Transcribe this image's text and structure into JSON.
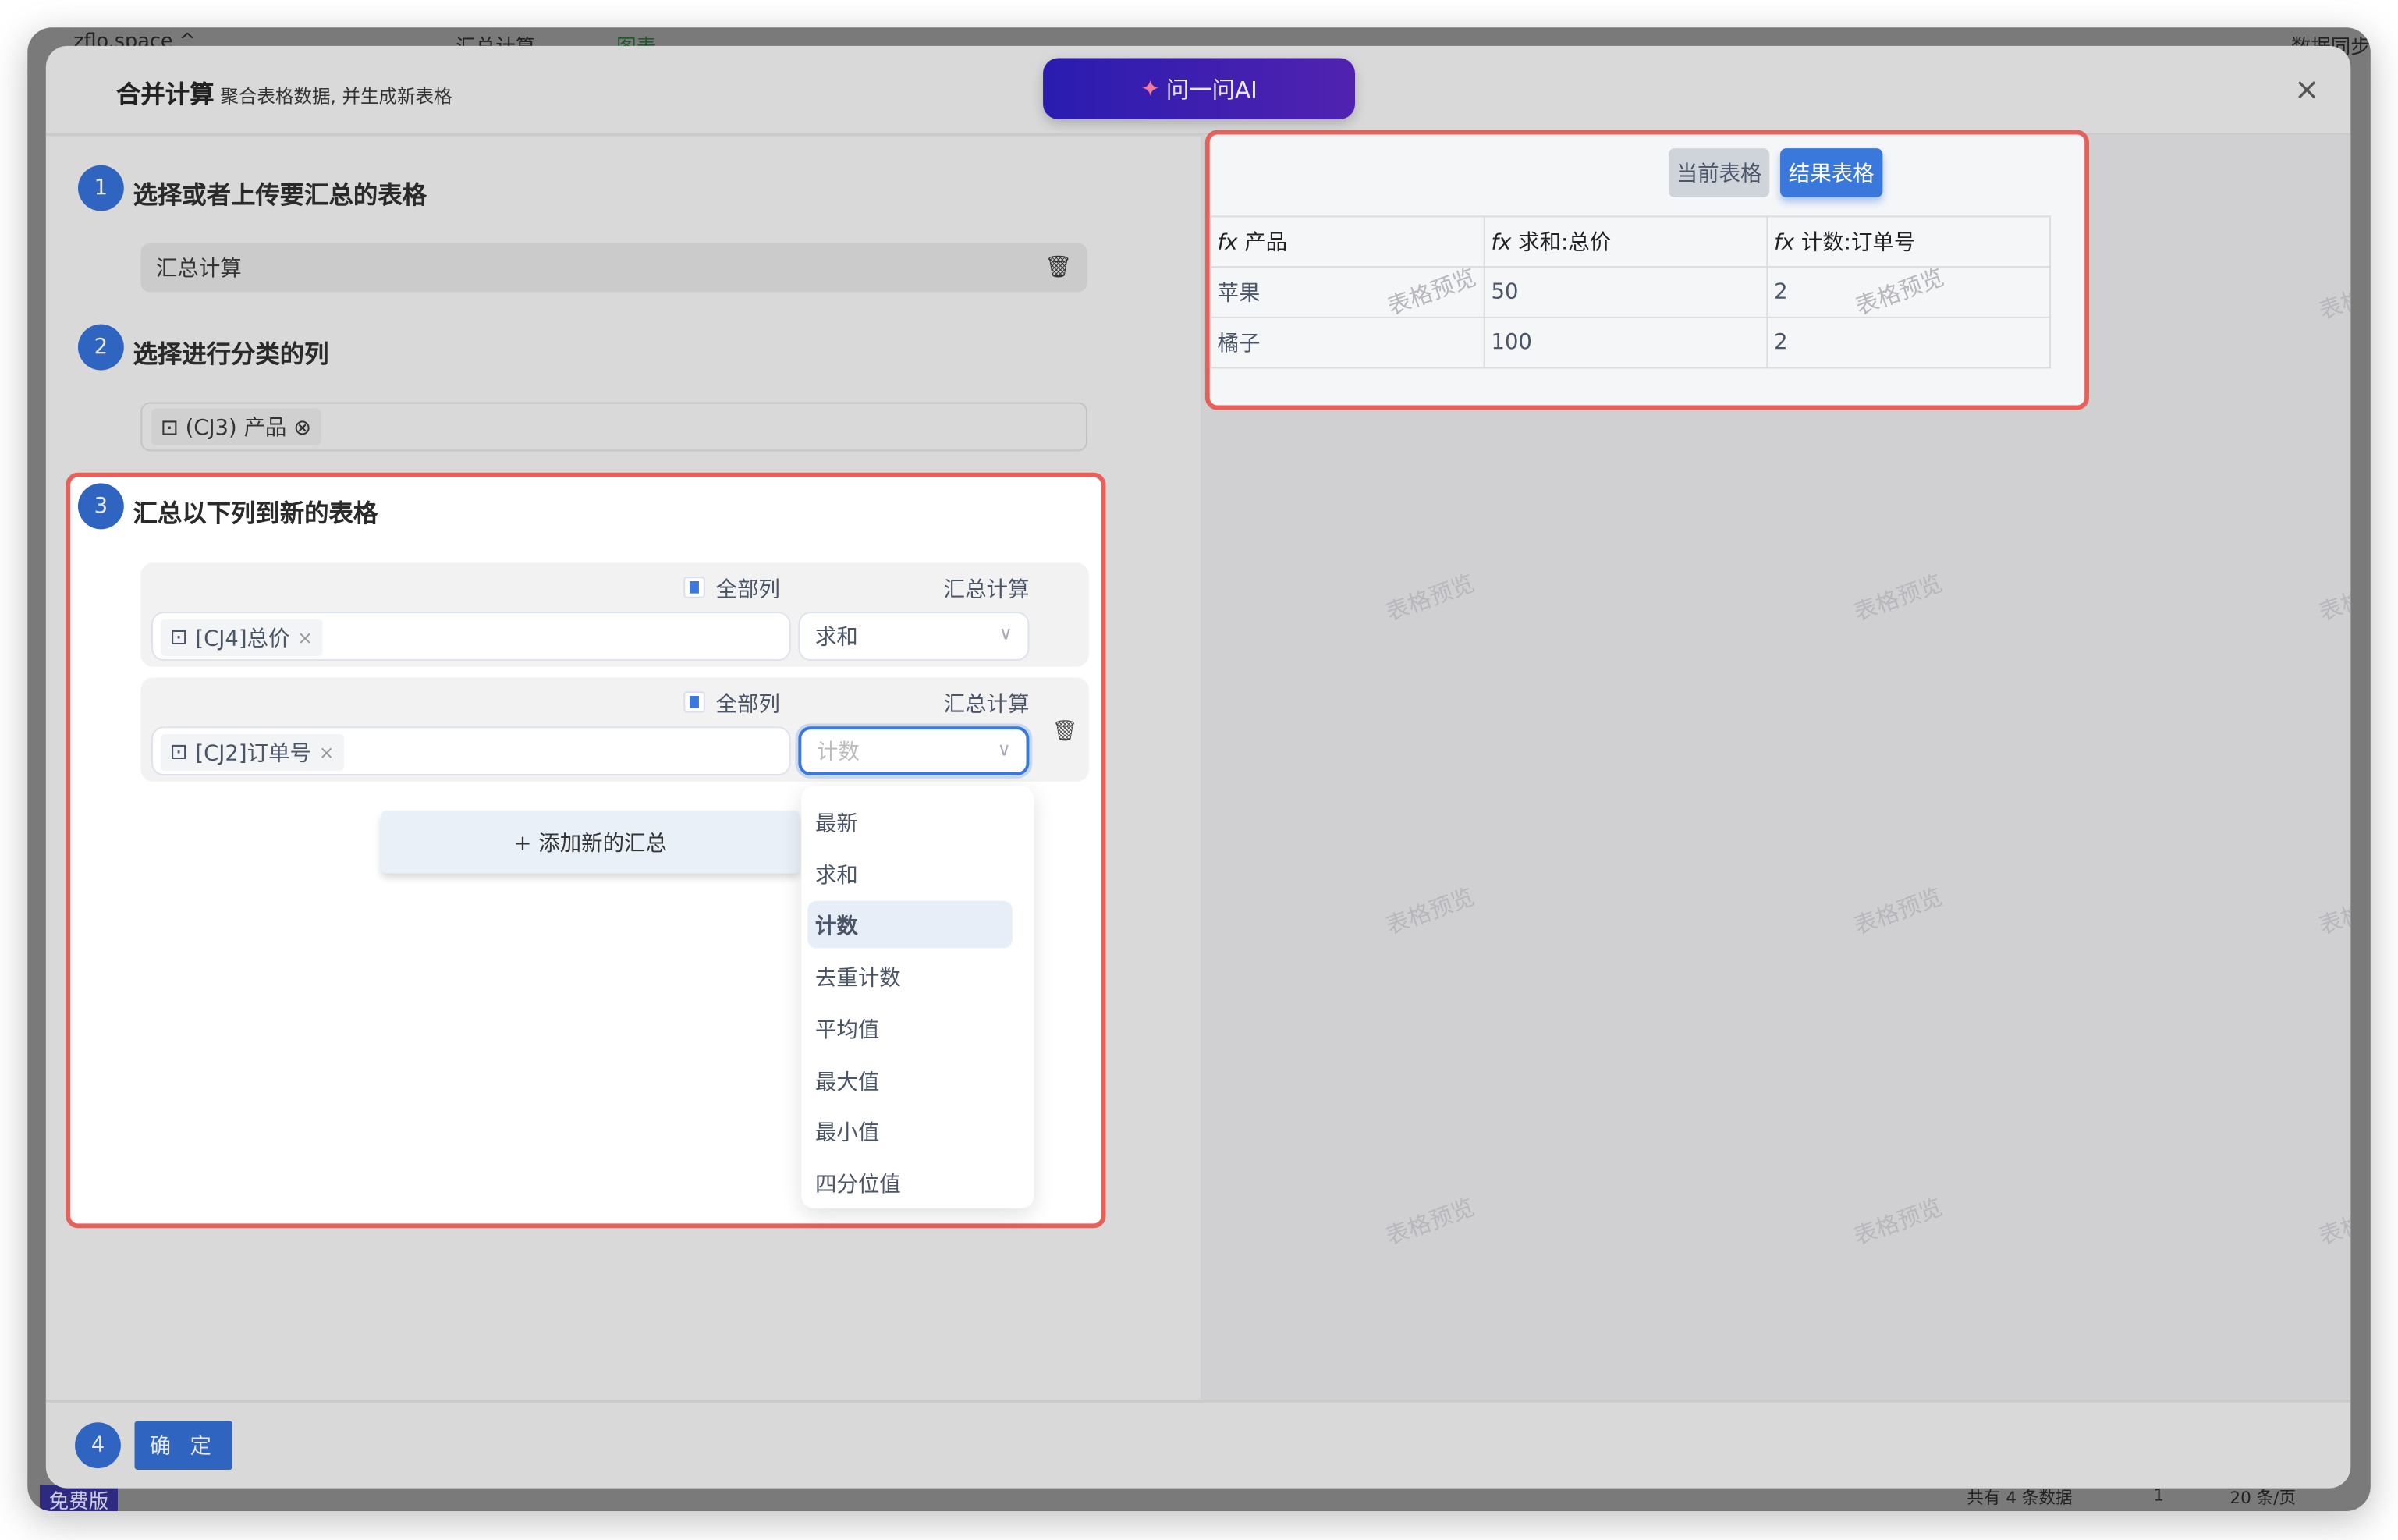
{
  "background_app": {
    "workspace": "zflo.space ^",
    "tab_active": "汇总计算",
    "tab_chart": "图表",
    "sync_label": "数据同步",
    "plan_badge": "免费版",
    "record_count": "共有 4 条数据",
    "page_number": "1",
    "page_size": "20 条/页"
  },
  "modal": {
    "title": "合并计算",
    "subtitle": "聚合表格数据, 并生成新表格",
    "ai_button": "问一问AI",
    "close": "×"
  },
  "step1": {
    "number": "1",
    "label": "选择或者上传要汇总的表格",
    "table_value": "汇总计算"
  },
  "step2": {
    "number": "2",
    "label": "选择进行分类的列",
    "tag": "(CJ3) 产品"
  },
  "step3": {
    "number": "3",
    "label": "汇总以下列到新的表格",
    "groups": [
      {
        "all_columns_label": "全部列",
        "aggregate_label": "汇总计算",
        "column_tag": "[CJ4]总价",
        "aggregate_value": "求和",
        "aggregate_placeholder": ""
      },
      {
        "all_columns_label": "全部列",
        "aggregate_label": "汇总计算",
        "column_tag": "[CJ2]订单号",
        "aggregate_value": "",
        "aggregate_placeholder": "计数"
      }
    ],
    "add_button": "+ 添加新的汇总",
    "dropdown_options": [
      "最新",
      "求和",
      "计数",
      "去重计数",
      "平均值",
      "最大值",
      "最小值",
      "四分位值"
    ],
    "dropdown_selected": "计数"
  },
  "step4": {
    "number": "4",
    "confirm_button": "确 定"
  },
  "preview": {
    "tab_current": "当前表格",
    "tab_result": "结果表格",
    "active_tab": "结果表格",
    "columns": [
      "产品",
      "求和:总价",
      "计数:订单号"
    ],
    "rows": [
      [
        "苹果",
        "50",
        "2"
      ],
      [
        "橘子",
        "100",
        "2"
      ]
    ],
    "watermark": "表格预览"
  },
  "colors": {
    "accent": "#2f64c0",
    "highlight_border": "#e8605a",
    "active_tab": "#3a78dc"
  }
}
